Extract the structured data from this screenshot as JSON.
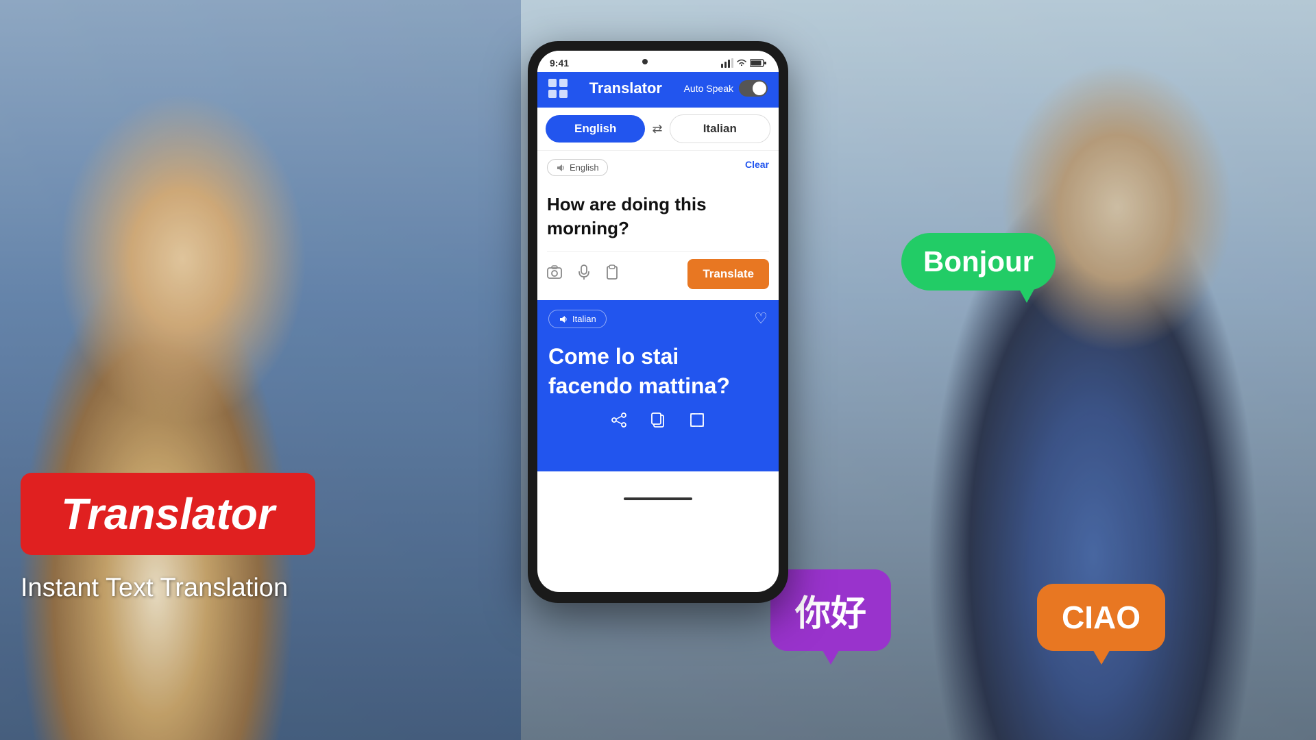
{
  "app": {
    "title": "Translator",
    "subtitle": "Instant Text Translation"
  },
  "header": {
    "title": "Translator",
    "auto_speak_label": "Auto Speak",
    "grid_icon": "grid-icon"
  },
  "status_bar": {
    "time": "9:41",
    "camera_icon": "camera-icon"
  },
  "language_selector": {
    "source_lang": "English",
    "target_lang": "Italian",
    "swap_icon": "⇄"
  },
  "input_panel": {
    "lang_badge": "English",
    "clear_label": "Clear",
    "input_text": "How are doing this morning?",
    "camera_icon": "camera-icon",
    "mic_icon": "mic-icon",
    "clipboard_icon": "clipboard-icon",
    "translate_btn": "Translate"
  },
  "result_panel": {
    "lang_badge": "Italian",
    "heart_icon": "heart-icon",
    "result_text": "Come lo stai facendo mattina?",
    "share_icon": "share-icon",
    "copy_icon": "copy-icon",
    "expand_icon": "expand-icon"
  },
  "badges": {
    "translator_label": "Translator",
    "subtitle": "Instant Text Translation",
    "bonjour": "Bonjour",
    "nihao": "你好",
    "ciao": "CIAO"
  },
  "colors": {
    "primary_blue": "#2255ee",
    "orange": "#e87722",
    "red": "#e02020",
    "green": "#22cc66",
    "purple": "#9933cc"
  }
}
